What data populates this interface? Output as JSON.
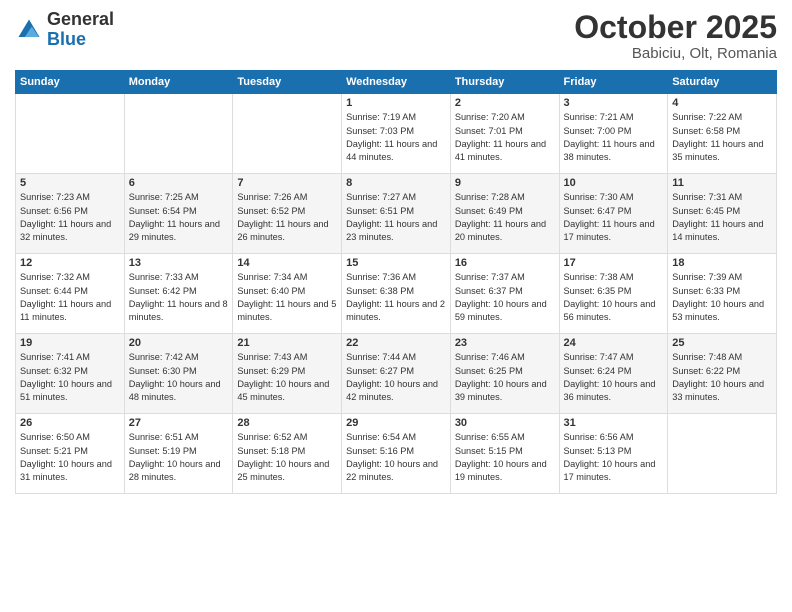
{
  "logo": {
    "general": "General",
    "blue": "Blue"
  },
  "title": "October 2025",
  "subtitle": "Babiciu, Olt, Romania",
  "days_of_week": [
    "Sunday",
    "Monday",
    "Tuesday",
    "Wednesday",
    "Thursday",
    "Friday",
    "Saturday"
  ],
  "weeks": [
    [
      {
        "day": "",
        "info": ""
      },
      {
        "day": "",
        "info": ""
      },
      {
        "day": "",
        "info": ""
      },
      {
        "day": "1",
        "info": "Sunrise: 7:19 AM\nSunset: 7:03 PM\nDaylight: 11 hours\nand 44 minutes."
      },
      {
        "day": "2",
        "info": "Sunrise: 7:20 AM\nSunset: 7:01 PM\nDaylight: 11 hours\nand 41 minutes."
      },
      {
        "day": "3",
        "info": "Sunrise: 7:21 AM\nSunset: 7:00 PM\nDaylight: 11 hours\nand 38 minutes."
      },
      {
        "day": "4",
        "info": "Sunrise: 7:22 AM\nSunset: 6:58 PM\nDaylight: 11 hours\nand 35 minutes."
      }
    ],
    [
      {
        "day": "5",
        "info": "Sunrise: 7:23 AM\nSunset: 6:56 PM\nDaylight: 11 hours\nand 32 minutes."
      },
      {
        "day": "6",
        "info": "Sunrise: 7:25 AM\nSunset: 6:54 PM\nDaylight: 11 hours\nand 29 minutes."
      },
      {
        "day": "7",
        "info": "Sunrise: 7:26 AM\nSunset: 6:52 PM\nDaylight: 11 hours\nand 26 minutes."
      },
      {
        "day": "8",
        "info": "Sunrise: 7:27 AM\nSunset: 6:51 PM\nDaylight: 11 hours\nand 23 minutes."
      },
      {
        "day": "9",
        "info": "Sunrise: 7:28 AM\nSunset: 6:49 PM\nDaylight: 11 hours\nand 20 minutes."
      },
      {
        "day": "10",
        "info": "Sunrise: 7:30 AM\nSunset: 6:47 PM\nDaylight: 11 hours\nand 17 minutes."
      },
      {
        "day": "11",
        "info": "Sunrise: 7:31 AM\nSunset: 6:45 PM\nDaylight: 11 hours\nand 14 minutes."
      }
    ],
    [
      {
        "day": "12",
        "info": "Sunrise: 7:32 AM\nSunset: 6:44 PM\nDaylight: 11 hours\nand 11 minutes."
      },
      {
        "day": "13",
        "info": "Sunrise: 7:33 AM\nSunset: 6:42 PM\nDaylight: 11 hours\nand 8 minutes."
      },
      {
        "day": "14",
        "info": "Sunrise: 7:34 AM\nSunset: 6:40 PM\nDaylight: 11 hours\nand 5 minutes."
      },
      {
        "day": "15",
        "info": "Sunrise: 7:36 AM\nSunset: 6:38 PM\nDaylight: 11 hours\nand 2 minutes."
      },
      {
        "day": "16",
        "info": "Sunrise: 7:37 AM\nSunset: 6:37 PM\nDaylight: 10 hours\nand 59 minutes."
      },
      {
        "day": "17",
        "info": "Sunrise: 7:38 AM\nSunset: 6:35 PM\nDaylight: 10 hours\nand 56 minutes."
      },
      {
        "day": "18",
        "info": "Sunrise: 7:39 AM\nSunset: 6:33 PM\nDaylight: 10 hours\nand 53 minutes."
      }
    ],
    [
      {
        "day": "19",
        "info": "Sunrise: 7:41 AM\nSunset: 6:32 PM\nDaylight: 10 hours\nand 51 minutes."
      },
      {
        "day": "20",
        "info": "Sunrise: 7:42 AM\nSunset: 6:30 PM\nDaylight: 10 hours\nand 48 minutes."
      },
      {
        "day": "21",
        "info": "Sunrise: 7:43 AM\nSunset: 6:29 PM\nDaylight: 10 hours\nand 45 minutes."
      },
      {
        "day": "22",
        "info": "Sunrise: 7:44 AM\nSunset: 6:27 PM\nDaylight: 10 hours\nand 42 minutes."
      },
      {
        "day": "23",
        "info": "Sunrise: 7:46 AM\nSunset: 6:25 PM\nDaylight: 10 hours\nand 39 minutes."
      },
      {
        "day": "24",
        "info": "Sunrise: 7:47 AM\nSunset: 6:24 PM\nDaylight: 10 hours\nand 36 minutes."
      },
      {
        "day": "25",
        "info": "Sunrise: 7:48 AM\nSunset: 6:22 PM\nDaylight: 10 hours\nand 33 minutes."
      }
    ],
    [
      {
        "day": "26",
        "info": "Sunrise: 6:50 AM\nSunset: 5:21 PM\nDaylight: 10 hours\nand 31 minutes."
      },
      {
        "day": "27",
        "info": "Sunrise: 6:51 AM\nSunset: 5:19 PM\nDaylight: 10 hours\nand 28 minutes."
      },
      {
        "day": "28",
        "info": "Sunrise: 6:52 AM\nSunset: 5:18 PM\nDaylight: 10 hours\nand 25 minutes."
      },
      {
        "day": "29",
        "info": "Sunrise: 6:54 AM\nSunset: 5:16 PM\nDaylight: 10 hours\nand 22 minutes."
      },
      {
        "day": "30",
        "info": "Sunrise: 6:55 AM\nSunset: 5:15 PM\nDaylight: 10 hours\nand 19 minutes."
      },
      {
        "day": "31",
        "info": "Sunrise: 6:56 AM\nSunset: 5:13 PM\nDaylight: 10 hours\nand 17 minutes."
      },
      {
        "day": "",
        "info": ""
      }
    ]
  ]
}
